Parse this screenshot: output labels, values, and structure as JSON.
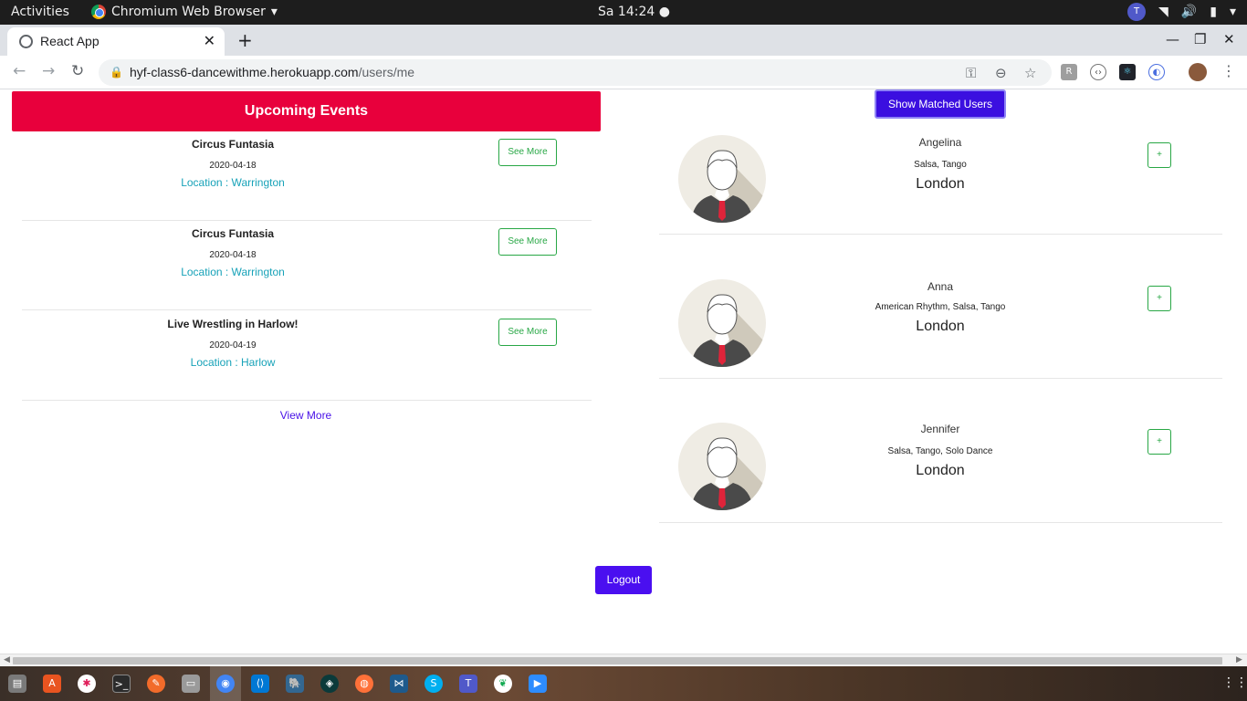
{
  "topbar": {
    "activities": "Activities",
    "app_name": "Chromium Web Browser",
    "clock": "Sa 14:24",
    "teams_label": "T"
  },
  "browser": {
    "tab_title": "React App",
    "url_host": "hyf-class6-dancewithme.herokuapp.com",
    "url_path": "/users/me"
  },
  "events": {
    "header": "Upcoming Events",
    "items": [
      {
        "title": "Circus Funtasia",
        "date": "2020-04-18",
        "location": "Location : Warrington",
        "button": "See More"
      },
      {
        "title": "Circus Funtasia",
        "date": "2020-04-18",
        "location": "Location : Warrington",
        "button": "See More"
      },
      {
        "title": "Live Wrestling in Harlow!",
        "date": "2020-04-19",
        "location": "Location : Harlow",
        "button": "See More"
      }
    ],
    "view_more": "View More"
  },
  "matches": {
    "show_button": "Show Matched Users",
    "users": [
      {
        "name": "Angelina",
        "dances": "Salsa, Tango",
        "city": "London",
        "add": "+"
      },
      {
        "name": "Anna",
        "dances": "American Rhythm, Salsa, Tango",
        "city": "London",
        "add": "+"
      },
      {
        "name": "Jennifer",
        "dances": "Salsa, Tango, Solo Dance",
        "city": "London",
        "add": "+"
      }
    ]
  },
  "logout": "Logout",
  "colors": {
    "events_header": "#e8003c",
    "primary_button": "#3b0fe0",
    "outline_green": "#28a745",
    "location_teal": "#17a2b8"
  }
}
